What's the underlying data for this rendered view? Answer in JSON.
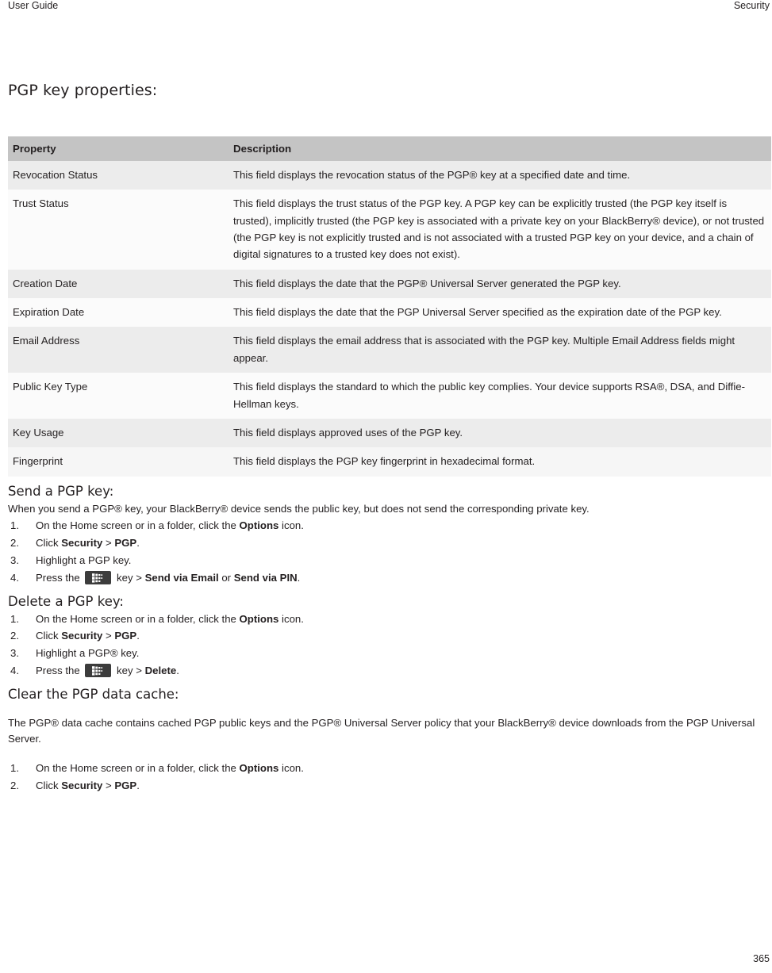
{
  "header": {
    "left": "User Guide",
    "right": "Security"
  },
  "section": {
    "title": "PGP key properties:"
  },
  "table": {
    "columns": [
      "Property",
      "Description"
    ],
    "rows": [
      {
        "property": "Revocation Status",
        "description": "This field displays the revocation status of the PGP® key at a specified date and time."
      },
      {
        "property": "Trust Status",
        "description": "This field displays the trust status of the PGP key. A PGP key can be explicitly trusted (the PGP key itself is trusted), implicitly trusted (the PGP key is associated with a private key on your BlackBerry® device), or not trusted (the PGP key is not explicitly trusted and is not associated with a trusted PGP key on your device, and a chain of digital signatures to a trusted key does not exist)."
      },
      {
        "property": "Creation Date",
        "description": "This field displays the date that the PGP® Universal Server generated the PGP key."
      },
      {
        "property": "Expiration Date",
        "description": "This field displays the date that the PGP Universal Server specified as the expiration date of the PGP key."
      },
      {
        "property": "Email Address",
        "description": "This field displays the email address that is associated with the PGP key. Multiple Email Address fields might appear."
      },
      {
        "property": "Public Key Type",
        "description": "This field displays the standard to which the public key complies. Your device supports RSA®, DSA, and Diffie-Hellman keys."
      },
      {
        "property": "Key Usage",
        "description": "This field displays approved uses of the PGP key."
      },
      {
        "property": "Fingerprint",
        "description": "This field displays the PGP key fingerprint in hexadecimal format."
      }
    ]
  },
  "send_section": {
    "heading": "Send a PGP key:",
    "intro": "When you send a PGP® key, your BlackBerry® device sends the public key, but does not send the corresponding private key.",
    "steps": [
      {
        "num": "1.",
        "pre": "On the Home screen or in a folder, click the ",
        "bold1": "Options",
        "mid": " icon.",
        "bold2": "",
        "post": ""
      },
      {
        "num": "2.",
        "pre": "Click ",
        "bold1": "Security",
        "mid": " > ",
        "bold2": "PGP",
        "post": "."
      },
      {
        "num": "3.",
        "pre": "Highlight a PGP key.",
        "bold1": "",
        "mid": "",
        "bold2": "",
        "post": ""
      },
      {
        "num": "4.",
        "pre": "Press the ",
        "icon": "blackberry-menu-key-icon",
        "mid": " key > ",
        "bold1": "Send via Email",
        "sep": " or ",
        "bold2": "Send via PIN",
        "post": "."
      }
    ]
  },
  "delete_section": {
    "heading": "Delete a PGP key:",
    "steps": [
      {
        "num": "1.",
        "pre": "On the Home screen or in a folder, click the ",
        "bold1": "Options",
        "mid": " icon.",
        "bold2": "",
        "post": ""
      },
      {
        "num": "2.",
        "pre": "Click ",
        "bold1": "Security",
        "mid": " > ",
        "bold2": "PGP",
        "post": "."
      },
      {
        "num": "3.",
        "pre": "Highlight a PGP® key.",
        "bold1": "",
        "mid": "",
        "bold2": "",
        "post": ""
      },
      {
        "num": "4.",
        "pre": "Press the ",
        "icon": "blackberry-menu-key-icon",
        "mid": " key > ",
        "bold1": "Delete",
        "sep": "",
        "bold2": "",
        "post": "."
      }
    ]
  },
  "cache_section": {
    "heading": "Clear the PGP data cache:",
    "intro": "The PGP® data cache contains cached PGP public keys and the PGP® Universal Server policy that your BlackBerry® device downloads from the PGP Universal Server.",
    "steps": [
      {
        "num": "1.",
        "pre": "On the Home screen or in a folder, click the ",
        "bold1": "Options",
        "mid": " icon.",
        "bold2": "",
        "post": ""
      },
      {
        "num": "2.",
        "pre": "Click ",
        "bold1": "Security",
        "mid": " > ",
        "bold2": "PGP",
        "post": "."
      }
    ]
  },
  "folio": {
    "page_number": "365"
  },
  "colors": {
    "text": "#231f20",
    "table_header_bg": "#c4c4c4",
    "table_shade_bg": "#ececec",
    "table_plain_bg": "#fbfbfb",
    "menu_key_bg": "#3c3c3c"
  }
}
